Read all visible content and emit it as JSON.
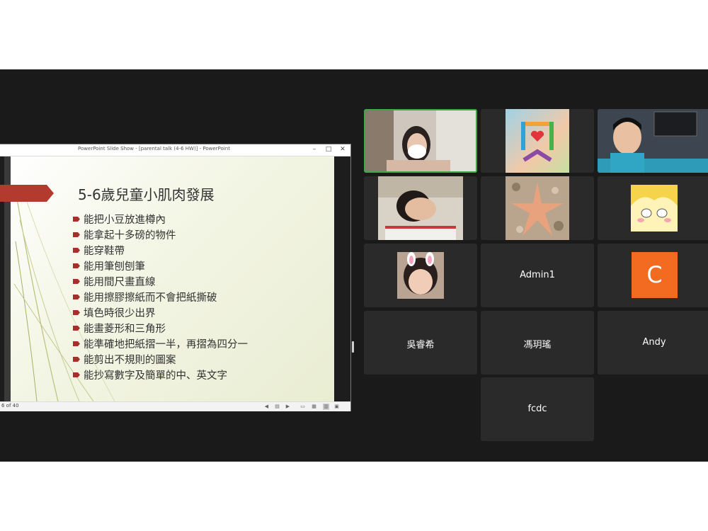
{
  "shared_window": {
    "title": "PowerPoint Slide Show - [parental talk (4-6 HW)] - PowerPoint",
    "controls": {
      "minimize": "–",
      "maximize": "□",
      "close": "✕"
    },
    "slide": {
      "heading": "5-6歲兒童小肌肉發展",
      "bullets": [
        "能把小豆放進樽內",
        "能拿起十多磅的物件",
        "能穿鞋帶",
        "能用筆刨刨筆",
        "能用間尺畫直線",
        "能用擦膠擦紙而不會把紙撕破",
        "填色時很少出界",
        "能畫菱形和三角形",
        "能準確地把紙摺一半，再摺為四分一",
        "能剪出不規則的圖案",
        "能抄寫數字及簡單的中、英文字"
      ],
      "accent_color": "#b23a2e",
      "bullet_color": "#a5302b"
    },
    "status_bar": {
      "slide_counter": "6 of 40",
      "icons": [
        "prev-icon",
        "notes-icon",
        "next-icon",
        "normal-view-icon",
        "slide-sorter-icon",
        "reading-view-icon",
        "slideshow-view-icon",
        "fullscreen-icon"
      ]
    }
  },
  "gallery": {
    "active_speaker_color": "#3ea748",
    "tiles": [
      {
        "id": "video-1",
        "type": "video",
        "subject": "woman wearing face mask"
      },
      {
        "id": "video-2",
        "type": "video",
        "subject": "logo with heart"
      },
      {
        "id": "video-3",
        "type": "video",
        "subject": "boy in front of computer"
      },
      {
        "id": "video-4",
        "type": "video",
        "subject": "child covering face"
      },
      {
        "id": "video-5",
        "type": "video",
        "subject": "starfish picture"
      },
      {
        "id": "video-6",
        "type": "video",
        "subject": "cartoon character"
      },
      {
        "id": "video-7",
        "type": "video",
        "subject": "girl with bunny ears filter"
      },
      {
        "id": "name-admin1",
        "type": "name",
        "name": "Admin1"
      },
      {
        "id": "avatar-c",
        "type": "avatar",
        "letter": "C",
        "color": "#f26b21"
      },
      {
        "id": "name-wu",
        "type": "name",
        "name": "吳睿希"
      },
      {
        "id": "name-feng",
        "type": "name",
        "name": "馮玥瑤"
      },
      {
        "id": "name-andy",
        "type": "name",
        "name": "Andy"
      },
      {
        "id": "name-fcdc",
        "type": "name",
        "name": "fcdc"
      }
    ]
  }
}
